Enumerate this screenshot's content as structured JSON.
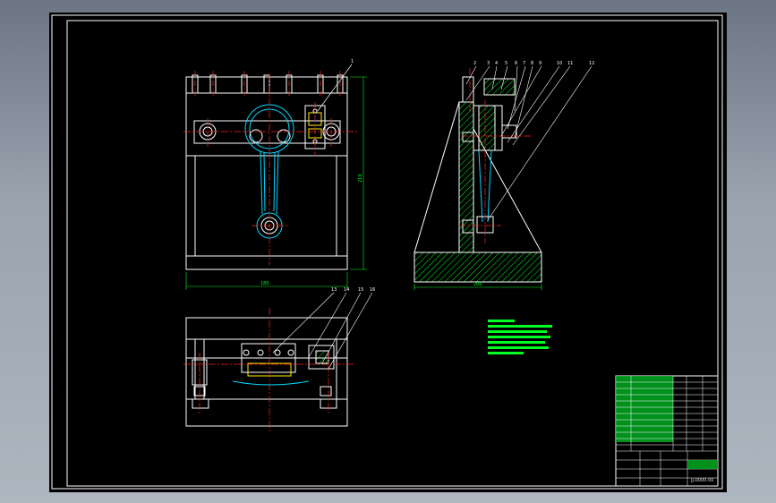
{
  "drawing": {
    "colors": {
      "background": "#000000",
      "outline": "#ffffff",
      "centerline": "#ff2222",
      "part": "#00d8ff",
      "hatch": "#00ff22",
      "dimension": "#00ff22",
      "leader": "#ffffff",
      "tech_notes": "#00ff22",
      "title_block_fill": "#00aa22"
    },
    "front_view": {
      "balloon": "1",
      "dim_height": "210",
      "dim_width": "180"
    },
    "side_view": {
      "balloons": [
        "2",
        "3",
        "4",
        "5",
        "6",
        "7",
        "8",
        "9",
        "10",
        "11",
        "12"
      ],
      "dim_base": "200"
    },
    "plan_view": {
      "balloons": [
        "13",
        "14",
        "15",
        "16"
      ]
    },
    "title_block": {
      "drawing_no": "JJ-0000-00"
    }
  }
}
